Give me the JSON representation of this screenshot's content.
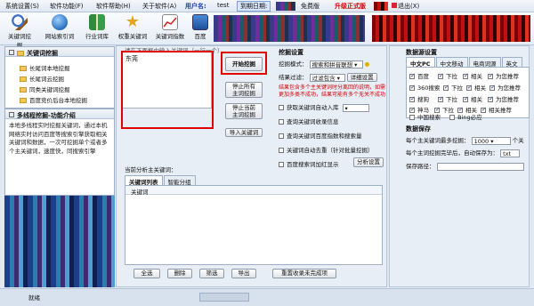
{
  "menubar": {
    "items": [
      "系统设置(S)",
      "软件功能(F)",
      "软件帮助(H)",
      "关于软件(A)"
    ],
    "username_label": "用户名:",
    "username": "test",
    "expiry_label": "到期日期:",
    "free_label": "免费版",
    "upgrade_label": "升级正式版",
    "exit_label": "退出(X)"
  },
  "toolbar": {
    "items": [
      {
        "label": "关键词挖掘",
        "icon": "search-icon"
      },
      {
        "label": "网站索引词",
        "icon": "globe-icon"
      },
      {
        "label": "行业词库",
        "icon": "book-icon"
      },
      {
        "label": "权重关键词",
        "icon": "star-icon"
      },
      {
        "label": "关键词指数",
        "icon": "chart-icon"
      },
      {
        "label": "百度",
        "icon": "monitor-icon"
      }
    ]
  },
  "leftnav": {
    "title": "关键词挖掘",
    "items": [
      "长尾词本地挖掘",
      "长尾词云挖掘",
      "同类关键词挖掘",
      "百度竞价后台本地挖掘"
    ],
    "desc_title": "多线程挖掘-功能介绍",
    "desc_text": "本地多线程实时挖掘关键词，通过本机网络实时访问百度等搜索引擎获取相关关键词和数据，一次可挖掘单个或者多个主关键词，速度快，同搜索引擎"
  },
  "main": {
    "input_caption": "请在下面框中输入关键词（一行一个）",
    "input_value": "东莞",
    "start_button": "开始挖掘",
    "stop_all_button": "停止所有\n主词挖掘",
    "stop_current_button": "停止当前\n主词挖掘",
    "import_button": "导入关键词",
    "current_label": "当前分析主关键词：",
    "tabs": [
      "关键词列表",
      "智能分组"
    ],
    "table_header": "关键词",
    "bottom_buttons": [
      "全选",
      "删除",
      "筛选",
      "导出",
      "重置收录未完成项"
    ]
  },
  "settings": {
    "title": "挖掘设置",
    "mode_label": "挖掘模式：",
    "mode_value": "搜索和拼音联想",
    "filter_label": "结果过滤：",
    "filter_value": "过滤包含",
    "filter_button": "详细设置",
    "note": "结果包含多个主关键词时分离回的说明，如需更加多类不成功，结果可能有多个无关不成功",
    "checks": [
      {
        "label": "获取关键词自动入库",
        "checked": false
      },
      {
        "label": "查询关键词收录信息",
        "checked": false
      },
      {
        "label": "查询关键词百度指数和搜索量",
        "checked": false
      },
      {
        "label": "关键词自动去重（针对批量挖掘）",
        "checked": false
      },
      {
        "label": "百度搜索词加红显示",
        "checked": false
      }
    ],
    "analysis_button": "分析设置"
  },
  "datasource": {
    "title": "数据源设置",
    "tabs": [
      "中文PC",
      "中文移动",
      "电商词源",
      "英文"
    ],
    "rows": [
      [
        "百度",
        "下拉",
        "相关",
        "为您推荐"
      ],
      [
        "360搜索",
        "下拉",
        "相关",
        "为您推荐"
      ],
      [
        "搜狗",
        "下拉",
        "相关",
        "为您推荐"
      ],
      [
        "神马",
        "下拉",
        "相关",
        "相关推荐"
      ]
    ],
    "extra": [
      "中国搜索",
      "Bing必应"
    ]
  },
  "save": {
    "title": "数据保存",
    "max_label": "每个主关键词最多挖掘：",
    "max_value": "1000",
    "max_unit": "个关",
    "auto_save_label": "每个主词挖掘完毕后，自动保存为：",
    "auto_save_value": "txt",
    "path_label": "保存路径："
  },
  "status": {
    "text": "就绪"
  },
  "colors": {
    "accent": "#e00000",
    "panel_border": "#9db0c8",
    "bg": "#dfe8f3"
  }
}
